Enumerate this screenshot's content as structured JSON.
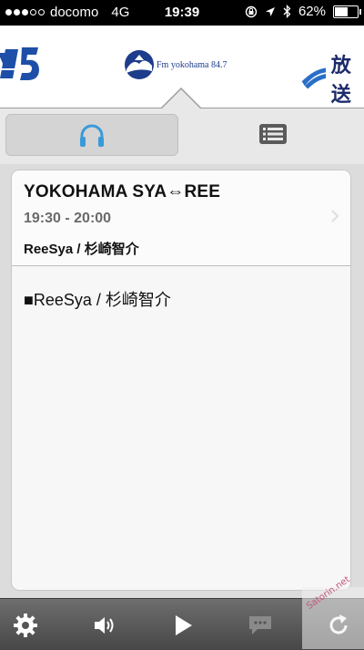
{
  "status_bar": {
    "carrier": "docomo",
    "network": "4G",
    "time": "19:39",
    "battery": "62%",
    "battery_level": 0.62
  },
  "stations": {
    "center_label": "Fm yokohama 84.7",
    "right_label": "放送"
  },
  "program": {
    "title": "YOKOHAMA SYA⇔REE",
    "time": "19:30 - 20:00",
    "personality": "ReeSya / 杉崎智介",
    "description": "■ReeSya / 杉崎智介"
  },
  "watermark": "Satorin.net",
  "colors": {
    "accent": "#3a9ad9",
    "toolbar": "#555555"
  },
  "icons": {
    "listen_tab": "headphones-icon",
    "list_tab": "list-icon",
    "settings": "gear-icon",
    "volume": "speaker-icon",
    "play": "play-icon",
    "chat": "chat-icon",
    "refresh": "refresh-icon"
  }
}
